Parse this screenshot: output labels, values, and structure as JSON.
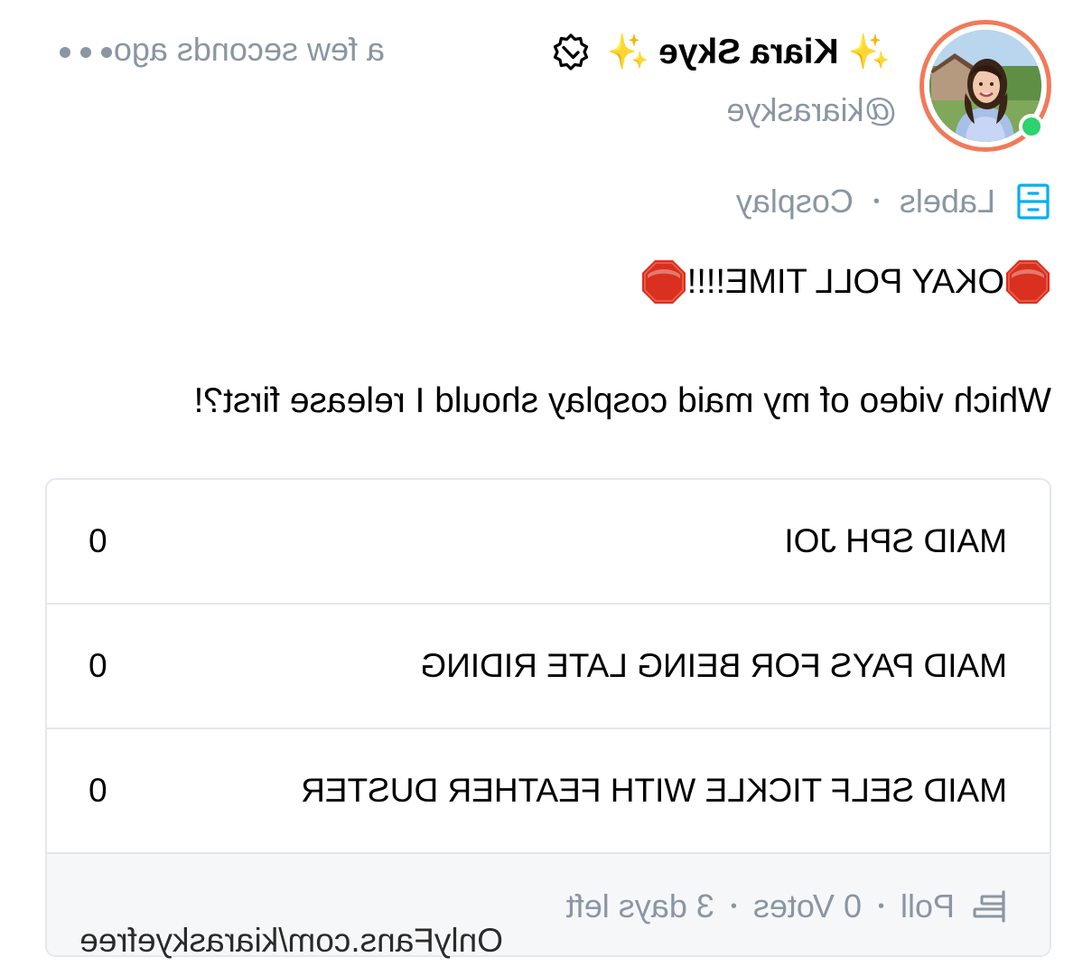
{
  "author": {
    "display_name": "Kiara Skye",
    "username": "@kiaraskye",
    "sparkle_left": "✨",
    "sparkle_right": "✨",
    "verified": true,
    "online": true,
    "avatar_ring_color": "#f17a59",
    "online_color": "#2dd36f"
  },
  "timestamp": "a few seconds ago",
  "menu_icon": "more-dots-icon",
  "labels": {
    "icon": "labels-drawer-icon",
    "label": "Labels",
    "separator": "•",
    "value": "Cosplay",
    "accent_color": "#00aff0"
  },
  "post": {
    "stop_icon": "🛑",
    "title": "OKAY POLL TIME!!!!",
    "body": "Which video of my maid cosplay should I release first?!"
  },
  "poll": {
    "options": [
      {
        "label": "MAID SPH JOI",
        "votes": "0"
      },
      {
        "label": "MAID PAYS FOR BEING LATE RIDING",
        "votes": "0"
      },
      {
        "label": "MAID SELF TICKLE WITH FEATHER DUSTER",
        "votes": "0"
      }
    ],
    "footer": {
      "icon": "poll-icon",
      "type": "Poll",
      "separator": "•",
      "votes": "0 Votes",
      "time_left": "3 days left"
    }
  },
  "watermark": "OnlyFans.com/kiaraskyefree",
  "colors": {
    "muted": "#8a96a3",
    "border": "#e4e8ec",
    "footer_bg": "#f6f7f9"
  }
}
